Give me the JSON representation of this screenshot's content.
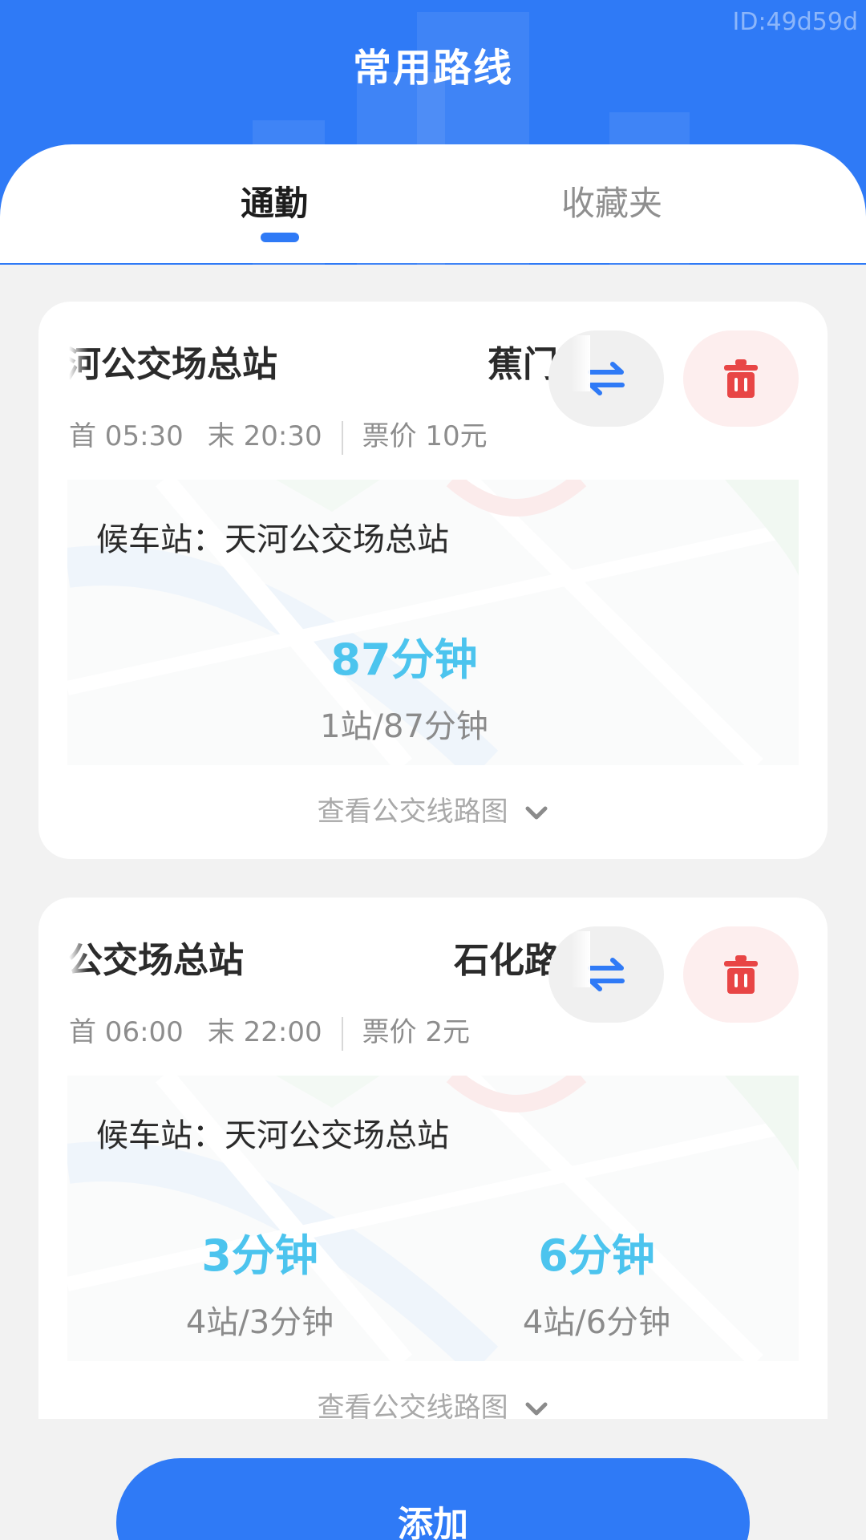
{
  "header": {
    "title": "常用路线",
    "page_id": "ID:49d59d"
  },
  "tabs": [
    {
      "label": "通勤",
      "active": true
    },
    {
      "label": "收藏夹",
      "active": false
    }
  ],
  "routes": [
    {
      "from_station": "天河公交场总站",
      "to_station": "蕉门",
      "first_bus": "首 05:30",
      "last_bus": "末 20:30",
      "fare": "票价 10元",
      "waiting_station": "候车站：天河公交场总站",
      "etas": [
        {
          "minutes": "87分钟",
          "detail": "1站/87分钟"
        }
      ],
      "view_map_label": "查看公交线路图"
    },
    {
      "from_station": "天河公交场总站",
      "to_station": "石化路",
      "first_bus": "首 06:00",
      "last_bus": "末 22:00",
      "fare": "票价 2元",
      "waiting_station": "候车站：天河公交场总站",
      "etas": [
        {
          "minutes": "3分钟",
          "detail": "4站/3分钟"
        },
        {
          "minutes": "6分钟",
          "detail": "4站/6分钟"
        }
      ],
      "view_map_label": "查看公交线路图"
    }
  ],
  "add_button_label": "添加",
  "colors": {
    "primary": "#2f7af6",
    "eta": "#4cc4ee",
    "delete": "#e84545",
    "delete_bg": "#fdeeee"
  },
  "icons": {
    "swap": "swap-arrows-icon",
    "delete": "trash-icon",
    "expand": "chevron-down-icon"
  }
}
